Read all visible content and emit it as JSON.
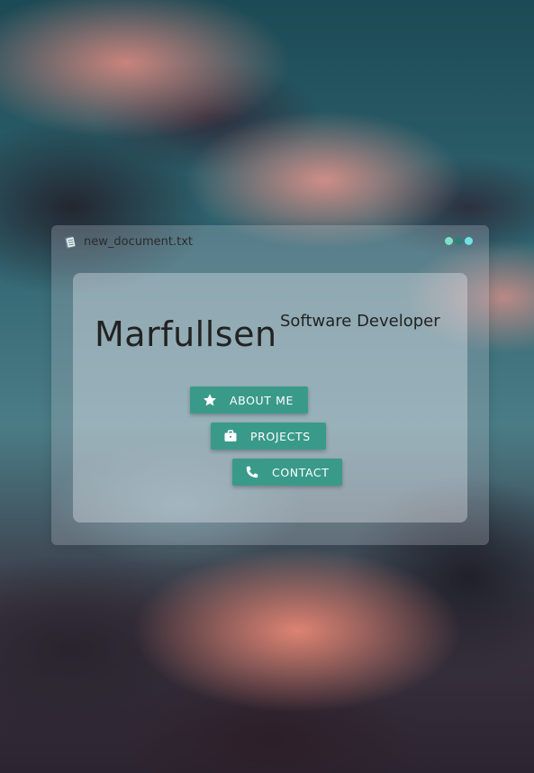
{
  "window": {
    "title": "new_document.txt",
    "title_icon": "document-icon",
    "dots": [
      {
        "name": "dot-mint",
        "color": "#7fe0c8"
      },
      {
        "name": "dot-teal",
        "color": "#2f7f7a"
      },
      {
        "name": "dot-cyan",
        "color": "#6fe3e3"
      }
    ]
  },
  "hero": {
    "name": "Marfullsen",
    "subtitle": "Software Developer"
  },
  "buttons": {
    "about": {
      "label": "ABOUT ME",
      "icon": "star-icon"
    },
    "projects": {
      "label": "PROJECTS",
      "icon": "briefcase-icon"
    },
    "contact": {
      "label": "CONTACT",
      "icon": "phone-icon"
    }
  },
  "colors": {
    "button": "#3a9a8a",
    "text": "#222222"
  }
}
